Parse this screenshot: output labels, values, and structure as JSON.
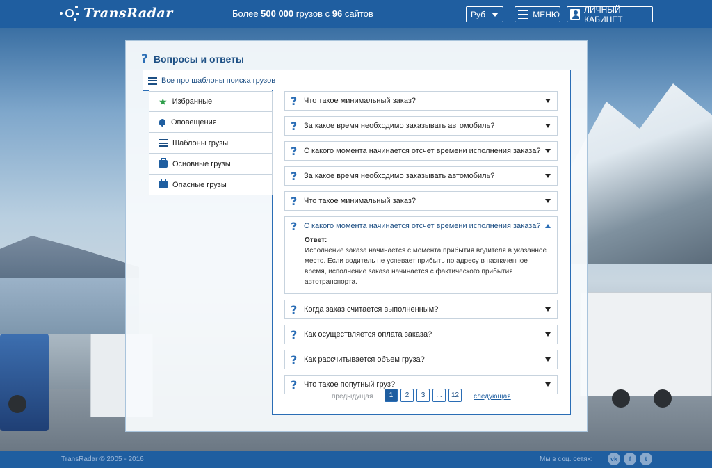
{
  "header": {
    "logo_text": "TransRadar",
    "tagline_prefix": "Более ",
    "tagline_count": "500 000",
    "tagline_mid": " грузов с ",
    "tagline_sites": "96",
    "tagline_suffix": " сайтов",
    "currency": "Руб",
    "menu_label": "МЕНЮ",
    "cabinet_label": "ЛИЧНЫЙ КАБИНЕТ"
  },
  "panel": {
    "title": "Вопросы и ответы",
    "section_title": "Все про шаблоны поиска грузов"
  },
  "tabs": [
    {
      "label": "Избранные",
      "icon": "star-icon"
    },
    {
      "label": "Оповещения",
      "icon": "bell-icon"
    },
    {
      "label": "Шаблоны грузы",
      "icon": "list-icon"
    },
    {
      "label": "Основные грузы",
      "icon": "bag-icon"
    },
    {
      "label": "Опасные грузы",
      "icon": "bag-icon"
    }
  ],
  "faq": [
    {
      "question": "Что такое минимальный заказ?"
    },
    {
      "question": "За какое время необходимо заказывать автомобиль?"
    },
    {
      "question": "С какого момента начинается отсчет времени исполнения заказа?"
    },
    {
      "question": "За какое время необходимо заказывать автомобиль?"
    },
    {
      "question": "Что такое минимальный заказ?"
    },
    {
      "question": "С какого момента начинается отсчет времени исполнения заказа?",
      "answer_label": "Ответ:",
      "answer": "Исполнение заказа начинается с момента прибытия водителя в указанное место. Если водитель не успевает прибыть по адресу в назначенное время, исполнение заказа начинается с фактического прибытия автотранспорта."
    },
    {
      "question": "Когда заказ считается выполненным?"
    },
    {
      "question": "Как осуществляется оплата заказа?"
    },
    {
      "question": "Как рассчитывается объем груза?"
    },
    {
      "question": "Что такое попутный груз?"
    }
  ],
  "pager": {
    "prev": "предыдущая",
    "pages": [
      "1",
      "2",
      "3",
      "...",
      "12"
    ],
    "next": "следующая"
  },
  "footer": {
    "copyright": "TransRadar © 2005 - 2016",
    "social_label": "Мы в соц. сетях:",
    "social": [
      "vk",
      "f",
      "t"
    ]
  },
  "colors": {
    "brand": "#1f5ea0",
    "accent": "#2a6db5",
    "star": "#2e9e4a"
  }
}
